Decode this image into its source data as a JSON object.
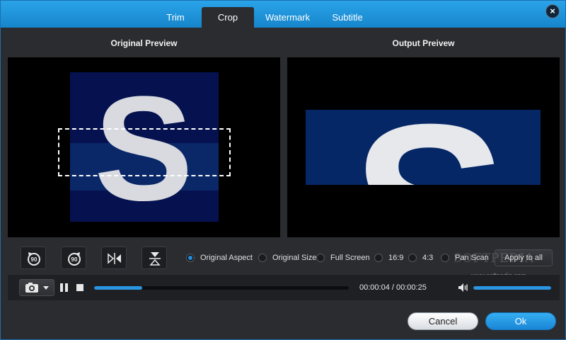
{
  "tabs": [
    {
      "label": "Trim",
      "active": false
    },
    {
      "label": "Crop",
      "active": true
    },
    {
      "label": "Watermark",
      "active": false
    },
    {
      "label": "Subtitle",
      "active": false
    }
  ],
  "preview": {
    "original_title": "Original Preview",
    "output_title": "Output Preivew",
    "image_letter": "S"
  },
  "controls": {
    "rotate_left_label": "90",
    "rotate_right_label": "90",
    "aspect_options": [
      {
        "label": "Original Aspect",
        "selected": true
      },
      {
        "label": "Original Size",
        "selected": false
      },
      {
        "label": "Full Screen",
        "selected": false
      },
      {
        "label": "16:9",
        "selected": false
      },
      {
        "label": "4:3",
        "selected": false
      },
      {
        "label": "Pan Scan",
        "selected": false
      }
    ],
    "apply_to_all": "Apply to all"
  },
  "watermark": {
    "logo_text": "SOFTPEDIA",
    "url": "www.softpedia.com"
  },
  "playback": {
    "time": "00:00:04 / 00:00:25",
    "progress_fraction": 0.19,
    "volume_fraction": 1.0
  },
  "footer": {
    "cancel": "Cancel",
    "ok": "Ok"
  },
  "colors": {
    "accent": "#1d8fe0",
    "header": "#1f95dc",
    "image_bg": "#06124f"
  },
  "icons": {
    "close": "close-icon",
    "rotate_left": "rotate-left-icon",
    "rotate_right": "rotate-right-icon",
    "flip_horizontal": "flip-horizontal-icon",
    "flip_vertical": "flip-vertical-icon",
    "camera": "camera-icon",
    "dropdown": "chevron-down-icon",
    "pause": "pause-icon",
    "stop": "stop-icon",
    "volume": "volume-icon"
  }
}
